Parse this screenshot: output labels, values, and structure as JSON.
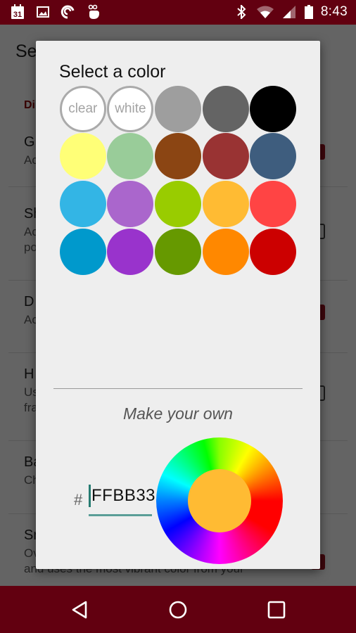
{
  "status_bar": {
    "left_icons": [
      "calendar-icon",
      "gallery-icon",
      "pushbullet-icon",
      "gesture-icon"
    ],
    "calendar_day": "31",
    "right_icons": [
      "bluetooth-icon",
      "wifi-icon",
      "cell-signal-icon",
      "battery-icon"
    ],
    "time": "8:43",
    "background": "#620010"
  },
  "app_bar": {
    "title": "Se"
  },
  "settings": {
    "section_header": "Di",
    "items": [
      {
        "title": "G",
        "summary": [
          "Ac"
        ],
        "checked": true
      },
      {
        "title": "Sh",
        "summary": [
          "Ac",
          "po"
        ],
        "checked": false
      },
      {
        "title": "D",
        "summary": [
          "Ac"
        ],
        "checked": true
      },
      {
        "title": "H",
        "summary": [
          "Us",
          "fra"
        ],
        "checked": false
      },
      {
        "title": "Ba",
        "summary": [
          "Ch"
        ],
        "checked": null
      },
      {
        "title": "Sr",
        "summary": [
          "Ov",
          "and uses the most vibrant color from your"
        ],
        "checked": true
      }
    ],
    "accent": "#9c1020"
  },
  "dialog": {
    "title": "Select a color",
    "swatches": [
      {
        "name": "clear",
        "label": "clear",
        "color": "#ffffff",
        "outlined": true
      },
      {
        "name": "white",
        "label": "white",
        "color": "#ffffff",
        "outlined": true
      },
      {
        "name": "light-gray",
        "label": "",
        "color": "#9e9e9e"
      },
      {
        "name": "dark-gray",
        "label": "",
        "color": "#646464"
      },
      {
        "name": "black",
        "label": "",
        "color": "#000000"
      },
      {
        "name": "light-yellow",
        "label": "",
        "color": "#ffff77"
      },
      {
        "name": "sage-green",
        "label": "",
        "color": "#99cc99"
      },
      {
        "name": "brown",
        "label": "",
        "color": "#8b4513"
      },
      {
        "name": "maroon",
        "label": "",
        "color": "#993333"
      },
      {
        "name": "slate-blue",
        "label": "",
        "color": "#3e5d7e"
      },
      {
        "name": "sky-blue",
        "label": "",
        "color": "#33b5e5"
      },
      {
        "name": "lavender",
        "label": "",
        "color": "#aa66cc"
      },
      {
        "name": "lime",
        "label": "",
        "color": "#99cc00"
      },
      {
        "name": "light-orange",
        "label": "",
        "color": "#ffbb33"
      },
      {
        "name": "light-red",
        "label": "",
        "color": "#ff4444"
      },
      {
        "name": "blue",
        "label": "",
        "color": "#0099cc"
      },
      {
        "name": "purple",
        "label": "",
        "color": "#9933cc"
      },
      {
        "name": "green",
        "label": "",
        "color": "#669900"
      },
      {
        "name": "orange",
        "label": "",
        "color": "#ff8800"
      },
      {
        "name": "red",
        "label": "",
        "color": "#cc0000"
      }
    ],
    "make_your_own": "Make your own",
    "hex_prefix": "#",
    "hex_value": "FFBB33",
    "selected_color": "#ffbb33"
  },
  "nav_bar": {
    "buttons": [
      "back-icon",
      "home-icon",
      "recents-icon"
    ]
  }
}
